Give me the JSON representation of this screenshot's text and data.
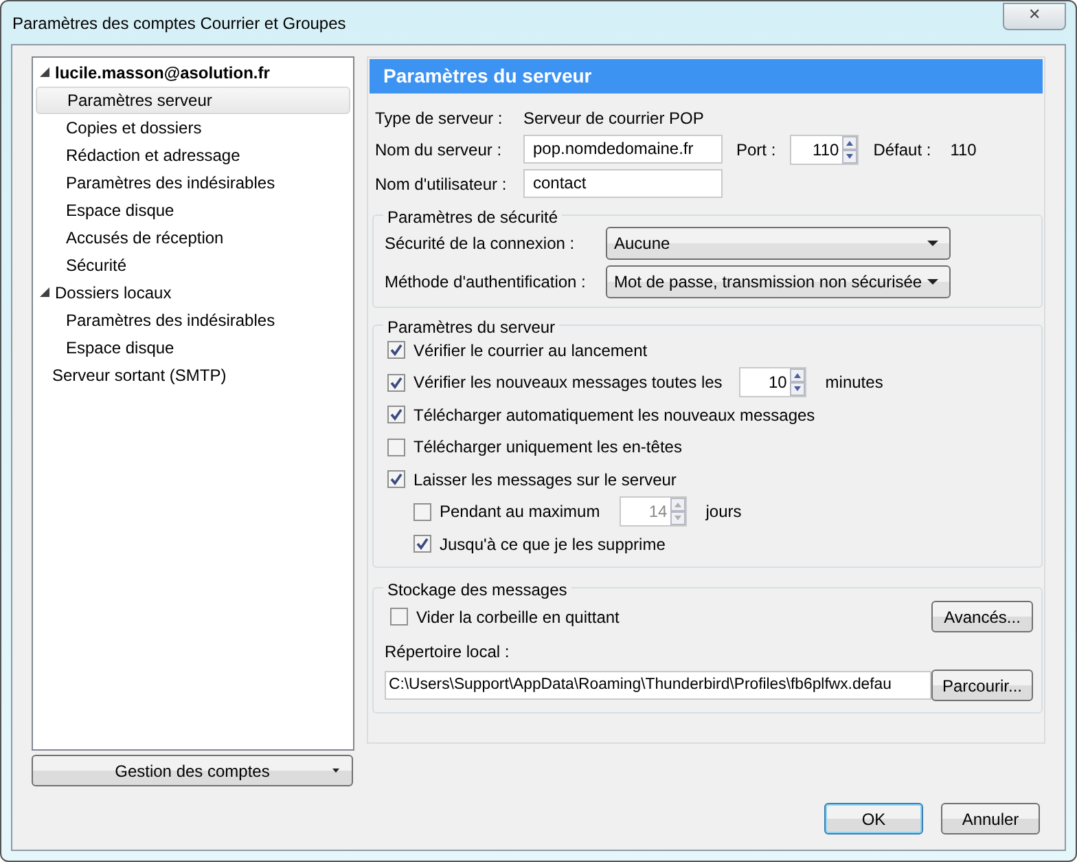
{
  "window": {
    "title": "Paramètres des comptes Courrier et Groupes",
    "close": "✕"
  },
  "account_tree": [
    {
      "label": "lucile.masson@asolution.fr",
      "expanded": true,
      "selected": false,
      "children": [
        {
          "label": "Paramètres serveur",
          "selected": true
        },
        {
          "label": "Copies et dossiers",
          "selected": false
        },
        {
          "label": "Rédaction et adressage",
          "selected": false
        },
        {
          "label": "Paramètres des indésirables",
          "selected": false
        },
        {
          "label": "Espace disque",
          "selected": false
        },
        {
          "label": "Accusés de réception",
          "selected": false
        },
        {
          "label": "Sécurité",
          "selected": false
        }
      ]
    },
    {
      "label": "Dossiers locaux",
      "expanded": true,
      "selected": false,
      "children": [
        {
          "label": "Paramètres des indésirables",
          "selected": false
        },
        {
          "label": "Espace disque",
          "selected": false
        }
      ]
    },
    {
      "label": "Serveur sortant (SMTP)",
      "selected": false
    }
  ],
  "manage_button": "Gestion des comptes",
  "panel_title": "Paramètres du serveur",
  "server_type": {
    "label": "Type de serveur :",
    "value": "Serveur de courrier POP"
  },
  "server_name": {
    "label": "Nom du serveur :",
    "value": "pop.nomdedomaine.fr"
  },
  "port": {
    "label": "Port :",
    "value": "110"
  },
  "default_port": {
    "label": "Défaut :",
    "value": "110"
  },
  "username": {
    "label": "Nom d'utilisateur :",
    "value": "contact"
  },
  "security": {
    "title": "Paramètres de sécurité",
    "rows": [
      {
        "label": "Sécurité de la connexion :",
        "value": "Aucune"
      },
      {
        "label": "Méthode d'authentification :",
        "value": "Mot de passe, transmission non sécurisée"
      }
    ]
  },
  "server_settings": {
    "title": "Paramètres du serveur",
    "items": [
      {
        "kind": "checkbox",
        "label": "Vérifier le courrier au lancement",
        "checked": true
      },
      {
        "kind": "spin",
        "label": "Vérifier les nouveaux messages toutes les",
        "checked": true,
        "value": "10",
        "unit": "minutes",
        "disabled": false
      },
      {
        "kind": "checkbox",
        "label": "Télécharger automatiquement les nouveaux messages",
        "checked": true
      },
      {
        "kind": "checkbox",
        "label": "Télécharger uniquement les en-têtes",
        "checked": false
      },
      {
        "kind": "checkbox",
        "label": "Laisser les messages sur le serveur",
        "checked": true,
        "children": [
          {
            "kind": "spin",
            "label": "Pendant au maximum",
            "checked": false,
            "value": "14",
            "unit": "jours",
            "disabled": true
          },
          {
            "kind": "checkbox",
            "label": "Jusqu'à ce que je les supprime",
            "checked": true
          }
        ]
      }
    ]
  },
  "storage": {
    "title": "Stockage des messages",
    "empty_trash": {
      "label": "Vider la corbeille en quittant",
      "checked": false
    },
    "advanced_button": "Avancés...",
    "directory_label": "Répertoire local :",
    "directory_value": "C:\\Users\\Support\\AppData\\Roaming\\Thunderbird\\Profiles\\fb6plfwx.defau",
    "browse_button": "Parcourir..."
  },
  "buttons": [
    {
      "label": "OK",
      "default": true
    },
    {
      "label": "Annuler",
      "default": false
    }
  ]
}
